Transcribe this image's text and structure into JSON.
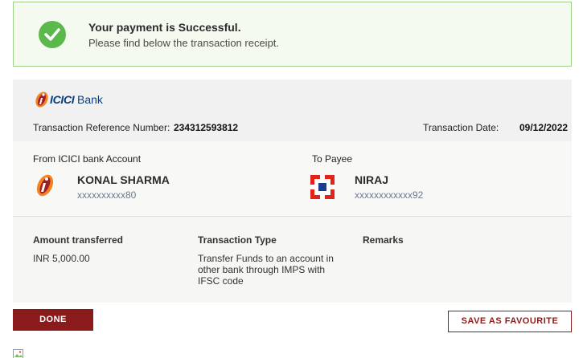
{
  "banner": {
    "title": "Your payment is Successful.",
    "subtitle": "Please find below the transaction receipt.",
    "icon": "check-circle-icon",
    "accent_color": "#5bb84b"
  },
  "receipt": {
    "bank_logo_text": "ICICI",
    "bank_logo_suffix": "Bank",
    "ref_label": "Transaction Reference Number:",
    "ref_value": "234312593812",
    "date_label": "Transaction Date:",
    "date_value": "09/12/2022",
    "from": {
      "label": "From ICICI bank Account",
      "name": "KONAL SHARMA",
      "account": "xxxxxxxxxx80"
    },
    "to": {
      "label": "To Payee",
      "name": "NIRAJ",
      "account": "xxxxxxxxxxxx92"
    },
    "amount_label": "Amount transferred",
    "amount_value": "INR 5,000.00",
    "type_label": "Transaction Type",
    "type_value": "Transfer Funds to an account in other bank through IMPS with IFSC code",
    "remarks_label": "Remarks"
  },
  "actions": {
    "done_label": "DONE",
    "favourite_label": "SAVE AS FAVOURITE",
    "brand_color": "#8b1a1a"
  }
}
